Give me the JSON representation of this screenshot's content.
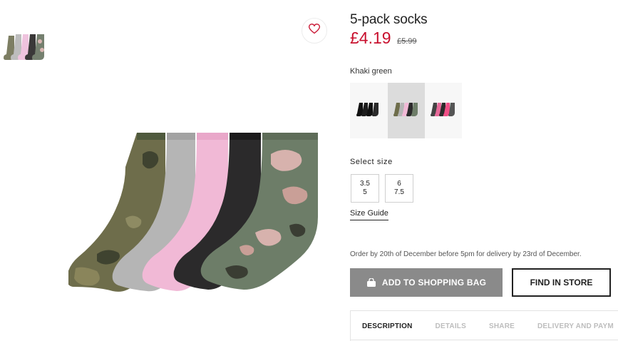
{
  "product": {
    "title": "5-pack socks",
    "price": "£4.19",
    "old_price": "£5.99",
    "color_name": "Khaki green"
  },
  "gallery": {
    "thumbnail_icon": "socks-thumbnail",
    "favourite_icon": "heart-icon"
  },
  "colors": [
    {
      "name": "black-socks-swatch",
      "selected": false
    },
    {
      "name": "khaki-camo-socks-swatch",
      "selected": true
    },
    {
      "name": "dark-grey-pink-socks-swatch",
      "selected": false
    }
  ],
  "size": {
    "label": "Select size",
    "options": [
      {
        "line1": "3.5",
        "line2": "5"
      },
      {
        "line1": "6",
        "line2": "7.5"
      }
    ],
    "guide": "Size Guide"
  },
  "delivery_note": "Order by 20th of December before 5pm for delivery by 23rd of December.",
  "buttons": {
    "add_to_bag": "ADD TO SHOPPING BAG",
    "find_in_store": "FIND IN STORE",
    "bag_icon": "shopping-bag-icon"
  },
  "tabs": [
    "DESCRIPTION",
    "DETAILS",
    "SHARE",
    "DELIVERY AND PAYM"
  ],
  "colors_theme": {
    "price_red": "#c8102e",
    "button_grey": "#8a8a8a"
  }
}
